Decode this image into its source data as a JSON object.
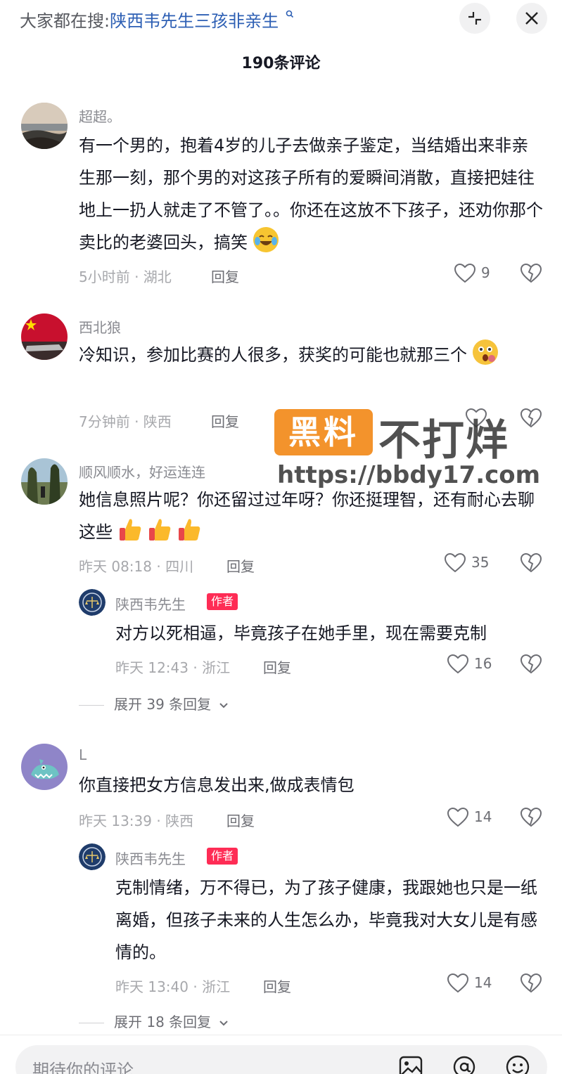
{
  "search": {
    "prefix": "大家都在搜:",
    "term": "陕西韦先生三孩非亲生"
  },
  "header": {
    "count_title": "190条评论",
    "collapse_icon": "collapse-icon",
    "close_icon": "close-icon"
  },
  "comments": [
    {
      "user": "超超。",
      "text": "有一个男的，抱着4岁的儿子去做亲子鉴定，当结婚出来非亲生那一刻，那个男的对这孩子所有的爱瞬间消散，直接把娃往地上一扔人就走了不管了。。你还在这放不下孩子，还劝你那个卖比的老婆回头，搞笑",
      "emoji": "crying-laughing-emoji",
      "meta": "5小时前 · 湖北",
      "reply": "回复",
      "likes": "9"
    },
    {
      "user": "西北狼",
      "text": "冷知识，参加比赛的人很多，获奖的可能也就那三个",
      "emoji": "shocked-emoji",
      "meta": "7分钟前 · 陕西",
      "reply": "回复",
      "likes": ""
    },
    {
      "user": "顺风顺水，好运连连",
      "text": "她信息照片呢？你还留过过年呀？你还挺理智，还有耐心去聊这些",
      "emoji": "thumbs-up-emoji",
      "meta": "昨天 08:18 · 四川",
      "reply": "回复",
      "likes": "35",
      "author_reply": {
        "user": "陕西韦先生",
        "tag": "作者",
        "text": "对方以死相逼，毕竟孩子在她手里，现在需要克制",
        "meta": "昨天 12:43 · 浙江",
        "reply": "回复",
        "likes": "16"
      },
      "expand": "展开 39 条回复"
    },
    {
      "user": "L",
      "text": "你直接把女方信息发出来,做成表情包",
      "meta": "昨天 13:39 · 陕西",
      "reply": "回复",
      "likes": "14",
      "author_reply": {
        "user": "陕西韦先生",
        "tag": "作者",
        "text": "克制情绪，万不得已，为了孩子健康，我跟她也只是一纸离婚，但孩子未来的人生怎么办，毕竟我对大女儿是有感情的。",
        "meta": "昨天 13:40 · 浙江",
        "reply": "回复",
        "likes": "14"
      },
      "expand": "展开 18 条回复"
    }
  ],
  "watermark": {
    "box_text": "黑料",
    "right_text": "不打烊",
    "url": "https://bbdy17.com"
  },
  "bottom": {
    "placeholder": "期待你的评论",
    "icons": [
      "image-icon",
      "at-icon",
      "emoji-icon"
    ]
  },
  "colors": {
    "search_term": "#2d5fb4",
    "author_tag": "#fe2c55",
    "watermark_orange": "#f28a1b"
  }
}
